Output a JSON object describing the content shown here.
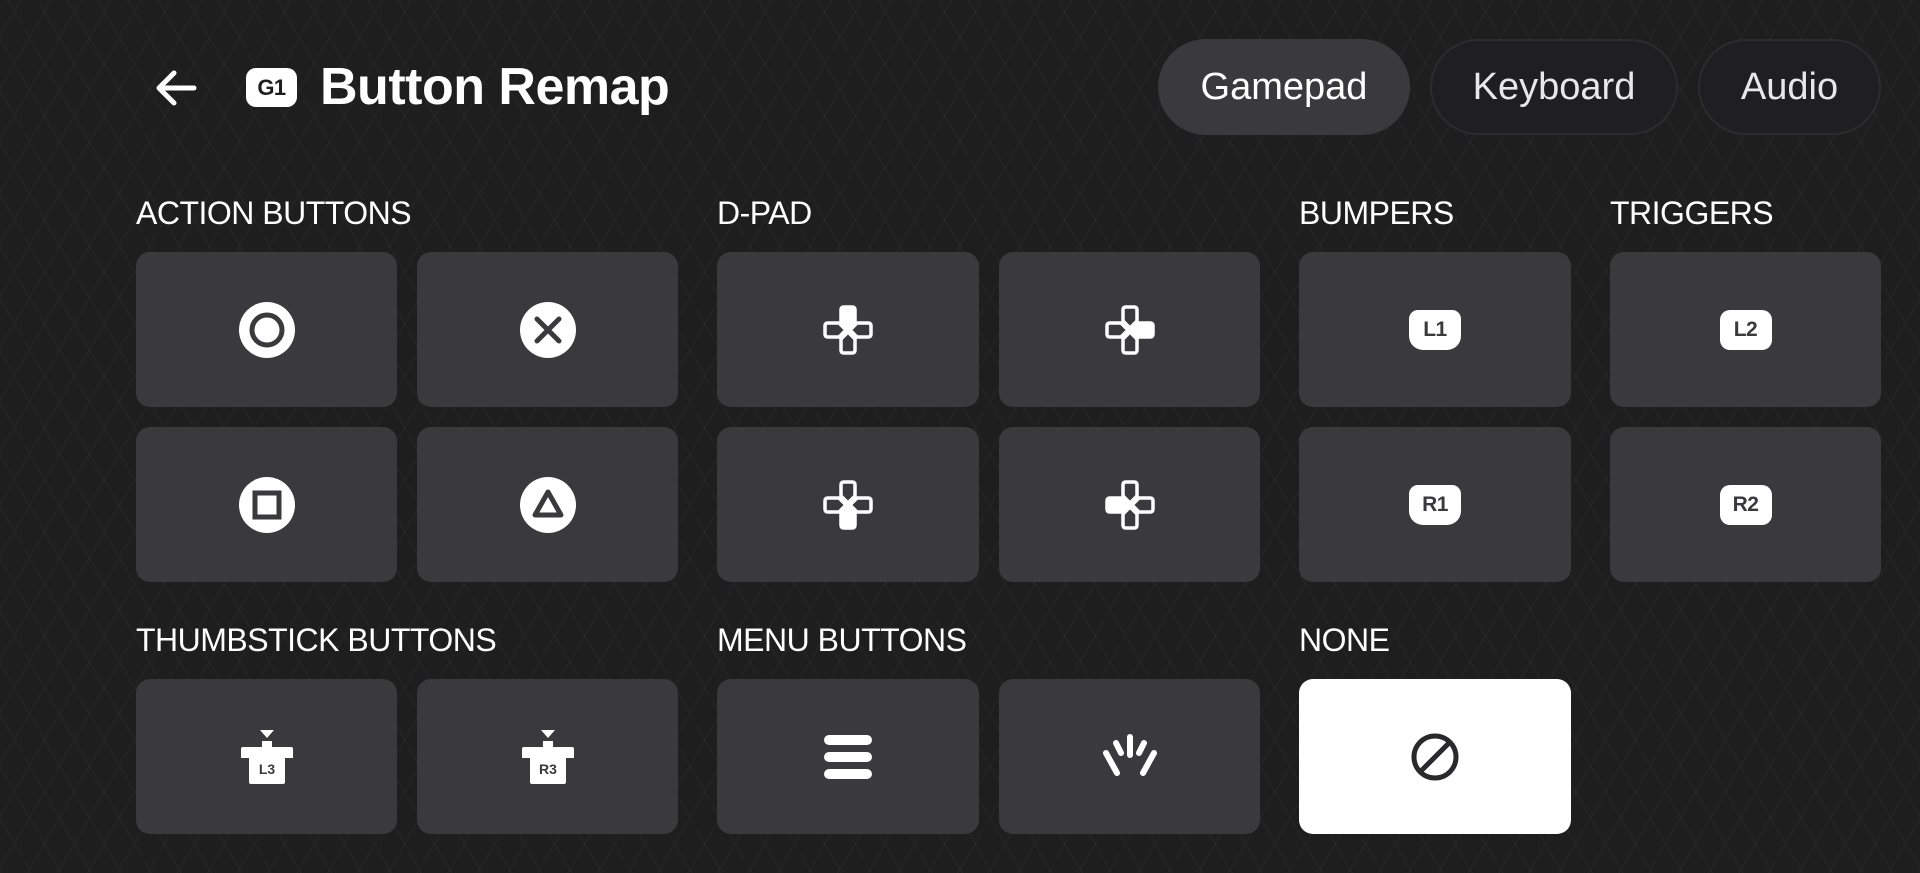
{
  "header": {
    "back_icon": "arrow-left-icon",
    "badge": "G1",
    "title": "Button Remap"
  },
  "tabs": [
    {
      "label": "Gamepad",
      "active": true
    },
    {
      "label": "Keyboard",
      "active": false
    },
    {
      "label": "Audio",
      "active": false
    }
  ],
  "sections": {
    "action_buttons": {
      "label": "ACTION BUTTONS",
      "items": [
        {
          "icon": "circle-button-icon"
        },
        {
          "icon": "cross-button-icon"
        },
        {
          "icon": "square-button-icon"
        },
        {
          "icon": "triangle-button-icon"
        }
      ]
    },
    "dpad": {
      "label": "D-PAD",
      "items": [
        {
          "icon": "dpad-up-icon"
        },
        {
          "icon": "dpad-right-icon"
        },
        {
          "icon": "dpad-down-icon"
        },
        {
          "icon": "dpad-left-icon"
        }
      ]
    },
    "bumpers": {
      "label": "BUMPERS",
      "items": [
        {
          "icon": "l1-bumper-icon",
          "text": "L1"
        },
        {
          "icon": "r1-bumper-icon",
          "text": "R1"
        }
      ]
    },
    "triggers": {
      "label": "TRIGGERS",
      "items": [
        {
          "icon": "l2-trigger-icon",
          "text": "L2"
        },
        {
          "icon": "r2-trigger-icon",
          "text": "R2"
        }
      ]
    },
    "thumbstick": {
      "label": "THUMBSTICK BUTTONS",
      "items": [
        {
          "icon": "l3-thumbstick-icon",
          "text": "L3"
        },
        {
          "icon": "r3-thumbstick-icon",
          "text": "R3"
        }
      ]
    },
    "menu": {
      "label": "MENU BUTTONS",
      "items": [
        {
          "icon": "menu-hamburger-icon"
        },
        {
          "icon": "share-button-icon"
        }
      ]
    },
    "none": {
      "label": "NONE",
      "items": [
        {
          "icon": "prohibited-icon",
          "selected": true
        }
      ]
    }
  },
  "colors": {
    "background": "#1e1e1f",
    "tile": "#3a3a3c",
    "tile_selected": "#ffffff",
    "text": "#ffffff"
  }
}
